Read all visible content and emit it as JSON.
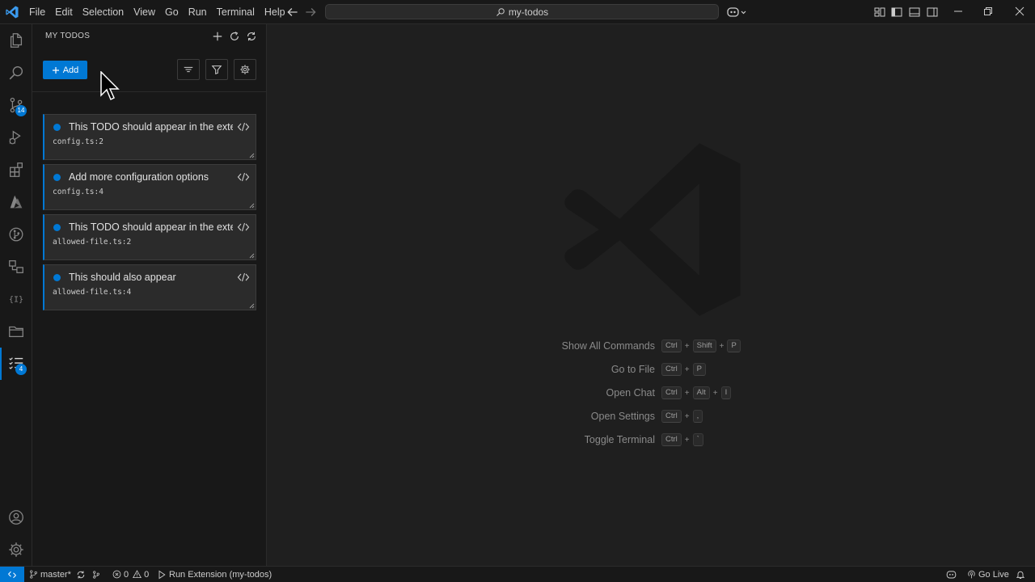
{
  "titlebar": {
    "menu": [
      "File",
      "Edit",
      "Selection",
      "View",
      "Go",
      "Run",
      "Terminal",
      "Help"
    ],
    "command_center": "my-todos"
  },
  "activitybar": {
    "source_control_badge": "14",
    "todos_badge": "4"
  },
  "sidebar": {
    "title": "MY TODOS",
    "add_label": "Add",
    "todos": [
      {
        "text": "This TODO should appear in the extension",
        "location": "config.ts:2"
      },
      {
        "text": "Add more configuration options",
        "location": "config.ts:4"
      },
      {
        "text": "This TODO should appear in the extension",
        "location": "allowed-file.ts:2"
      },
      {
        "text": "This should also appear",
        "location": "allowed-file.ts:4"
      }
    ]
  },
  "editor": {
    "shortcuts": [
      {
        "label": "Show All Commands",
        "keys": [
          "Ctrl",
          "Shift",
          "P"
        ]
      },
      {
        "label": "Go to File",
        "keys": [
          "Ctrl",
          "P"
        ]
      },
      {
        "label": "Open Chat",
        "keys": [
          "Ctrl",
          "Alt",
          "I"
        ]
      },
      {
        "label": "Open Settings",
        "keys": [
          "Ctrl",
          ","
        ]
      },
      {
        "label": "Toggle Terminal",
        "keys": [
          "Ctrl",
          "`"
        ]
      }
    ]
  },
  "statusbar": {
    "branch": "master*",
    "errors": "0",
    "warnings": "0",
    "run_task": "Run Extension (my-todos)",
    "go_live": "Go Live"
  },
  "colors": {
    "accent": "#0078d4",
    "background": "#1f1f1f",
    "chrome": "#181818"
  }
}
